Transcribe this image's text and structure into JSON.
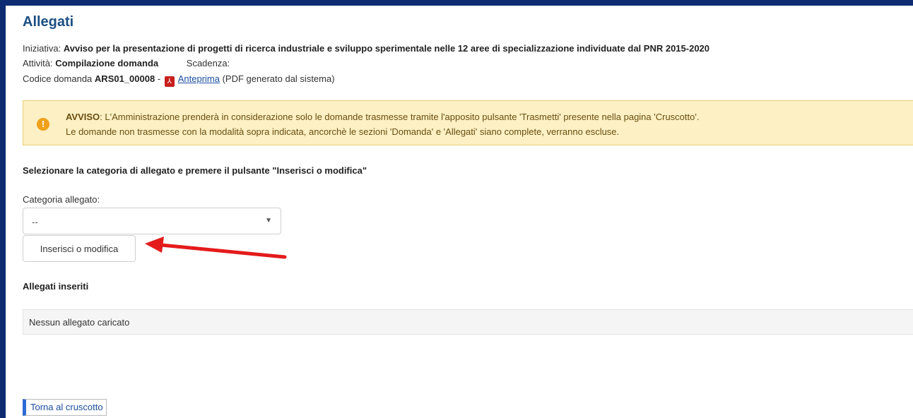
{
  "page": {
    "title": "Allegati"
  },
  "info": {
    "iniziativa_label": "Iniziativa:",
    "iniziativa_value": "Avviso per la presentazione di progetti di ricerca industriale e sviluppo sperimentale nelle 12 aree di specializzazione individuate dal PNR 2015-2020",
    "attivita_label": "Attività:",
    "attivita_value": "Compilazione domanda",
    "scadenza_label": "Scadenza:",
    "codice_label": "Codice domanda",
    "codice_value": "ARS01_00008",
    "separator": "-",
    "anteprima_link": "Anteprima",
    "anteprima_note": "(PDF generato dal sistema)"
  },
  "alert": {
    "title": "AVVISO",
    "line1": ": L'Amministrazione prenderà in considerazione solo le domande trasmesse tramite l'apposito pulsante 'Trasmetti' presente nella pagina 'Cruscotto'.",
    "line2": "Le domande non trasmesse con la modalità sopra indicata, ancorchè le sezioni 'Domanda' e 'Allegati' siano complete, verranno escluse.",
    "icon": "exclamation-circle-icon",
    "icon_glyph": "!",
    "color": "#f0a11c"
  },
  "form": {
    "instruction": "Selezionare la categoria di allegato e premere il pulsante \"Inserisci o modifica\"",
    "category_label": "Categoria allegato:",
    "category_selected": "--",
    "button_label": "Inserisci o modifica"
  },
  "attachments": {
    "heading": "Allegati inseriti",
    "empty_text": "Nessun allegato caricato"
  },
  "footer": {
    "back_link": "Torna al cruscotto"
  },
  "colors": {
    "frame": "#0d2b72",
    "title": "#1c4f83",
    "arrow": "#e41b1b"
  }
}
